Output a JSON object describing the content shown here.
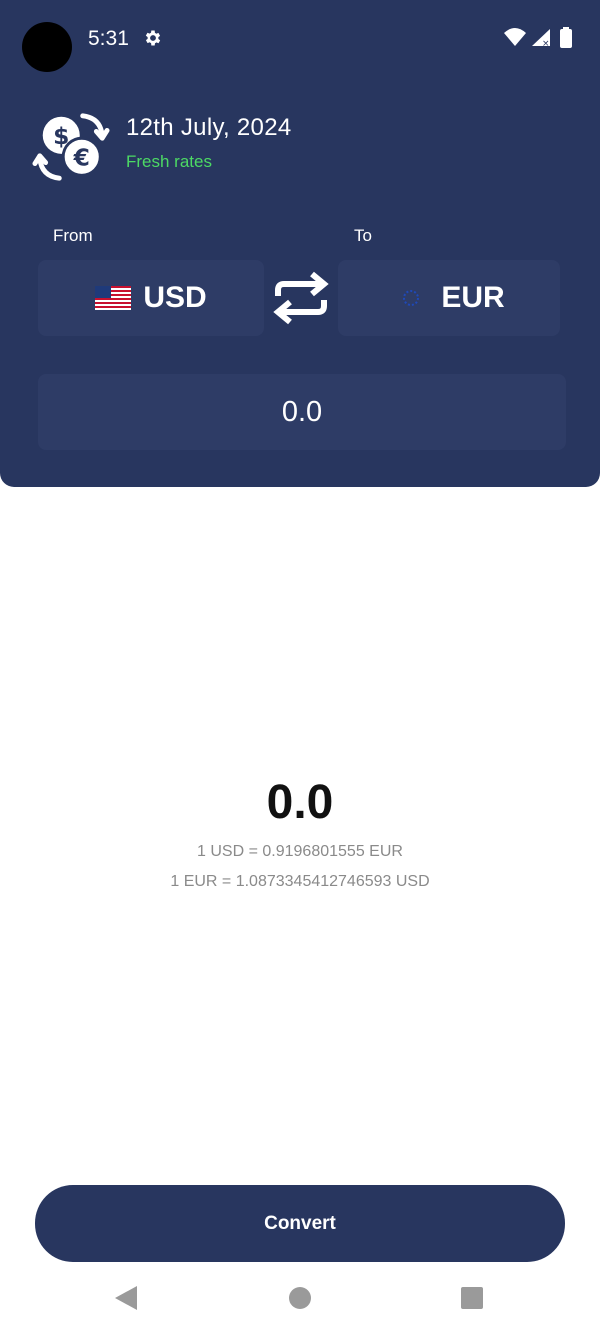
{
  "status_bar": {
    "time": "5:31",
    "icons": [
      "settings-icon",
      "wifi-icon",
      "signal-icon",
      "battery-icon"
    ]
  },
  "header": {
    "logo_icon": "currency-exchange-icon",
    "date": "12th July, 2024",
    "rates_status": "Fresh rates",
    "rates_status_color": "#4cd964",
    "background_color": "#28365f"
  },
  "converter": {
    "from_label": "From",
    "to_label": "To",
    "from_currency": "USD",
    "from_flag": "us-flag-icon",
    "to_currency": "EUR",
    "to_flag": "eu-flag-icon",
    "swap_icon": "swap-icon",
    "amount": "0.0"
  },
  "result": {
    "value": "0.0",
    "rate_line_1": "1 USD = 0.9196801555 EUR",
    "rate_line_2": "1 EUR = 1.0873345412746593 USD"
  },
  "actions": {
    "convert_label": "Convert"
  },
  "nav_bar": {
    "icons": [
      "back-icon",
      "home-icon",
      "recents-icon"
    ]
  }
}
